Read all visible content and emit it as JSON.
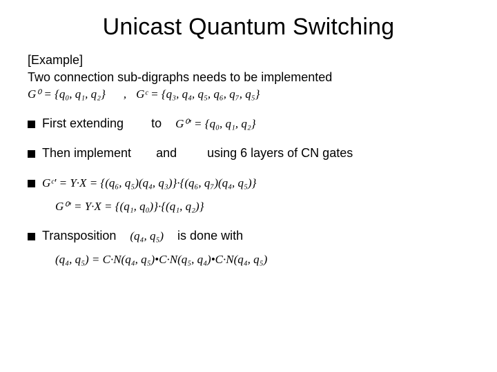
{
  "title": "Unicast Quantum Switching",
  "example_label": "[Example]",
  "intro": "Two connection sub-digraphs needs to be implemented",
  "eq_G0": "G⁰ = {q₀, q₁, q₂}",
  "comma": ",",
  "eq_GC": "Gᶜ = {q₃, q₄, q₅, q₆, q₇, q₅}",
  "first_extending": "First extending",
  "to": "to",
  "eq_G0p": "G⁰ʹ = {q₀, q₁, q₂}",
  "then_implement": "Then implement",
  "and": "and",
  "using_layers": "using 6 layers of CN gates",
  "eq_Gc_YX": "Gᶜʹ = Y·X = {(q₆, q₅)(q₄, q₃)}·{(q₆, q₇)(q₄, q₅)}",
  "eq_G0_YX": "G⁰ʹ = Y·X = {(q₁, q₀)}·{(q₁, q₂)}",
  "transposition": "Transposition",
  "pair_q4q5": "(q₄, q₅)",
  "is_done_with": "is done with",
  "eq_CN": "(q₄, q₅) = C·N(q₄, q₅)•C·N(q₅, q₄)•C·N(q₄, q₅)"
}
